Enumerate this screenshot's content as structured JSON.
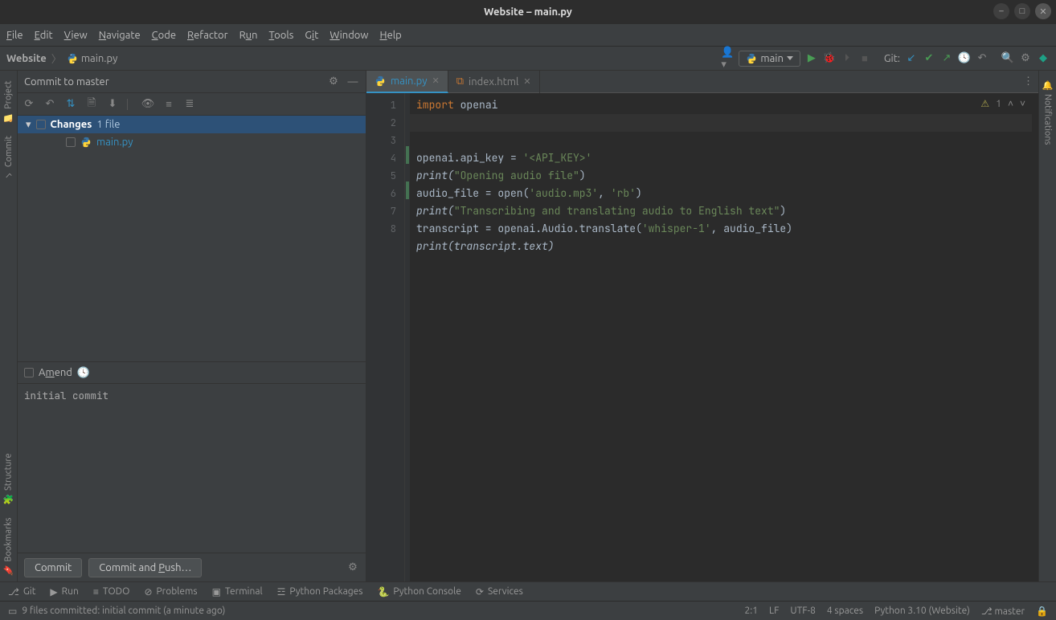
{
  "titlebar": {
    "title": "Website – main.py"
  },
  "menu": {
    "file": "File",
    "edit": "Edit",
    "view": "View",
    "navigate": "Navigate",
    "code": "Code",
    "refactor": "Refactor",
    "run": "Run",
    "tools": "Tools",
    "git": "Git",
    "window": "Window",
    "help": "Help"
  },
  "breadcrumb": {
    "project": "Website",
    "file": "main.py"
  },
  "toolbar": {
    "run_config": "main",
    "git_label": "Git:"
  },
  "commit": {
    "title": "Commit to master",
    "changes": "Changes",
    "count": "1 file",
    "file": "main.py",
    "amend": "Amend",
    "message": "initial commit",
    "commit_btn": "Commit",
    "push_btn": "Commit and Push…"
  },
  "tabs": {
    "active": "main.py",
    "other": "index.html"
  },
  "warn": {
    "count": "1"
  },
  "code": {
    "l1": {
      "kw": "import",
      "rest": " openai"
    },
    "l3": {
      "a": "openai.api_key = ",
      "s": "'<API_KEY>'"
    },
    "l4": {
      "a": "print(",
      "s": "\"Opening audio file\"",
      "b": ")"
    },
    "l5": {
      "a": "audio_file = open(",
      "s1": "'audio.mp3'",
      "c": ", ",
      "s2": "'rb'",
      "b": ")"
    },
    "l6": {
      "a": "print(",
      "s": "\"Transcribing and translating audio to English text\"",
      "b": ")"
    },
    "l7": {
      "a": "transcript = openai.Audio.translate(",
      "s": "'whisper-1'",
      "b": ", audio_file)"
    },
    "l8": {
      "a": "print(transcript.text)"
    }
  },
  "left_tabs": {
    "project": "Project",
    "commit": "Commit",
    "structure": "Structure",
    "bookmarks": "Bookmarks"
  },
  "right_tabs": {
    "notifications": "Notifications"
  },
  "bottom": {
    "git": "Git",
    "run": "Run",
    "todo": "TODO",
    "problems": "Problems",
    "terminal": "Terminal",
    "pypkg": "Python Packages",
    "pycon": "Python Console",
    "services": "Services"
  },
  "status": {
    "msg": "9 files committed: initial commit (a minute ago)",
    "pos": "2:1",
    "lf": "LF",
    "enc": "UTF-8",
    "indent": "4 spaces",
    "py": "Python 3.10 (Website)",
    "branch": "master"
  }
}
